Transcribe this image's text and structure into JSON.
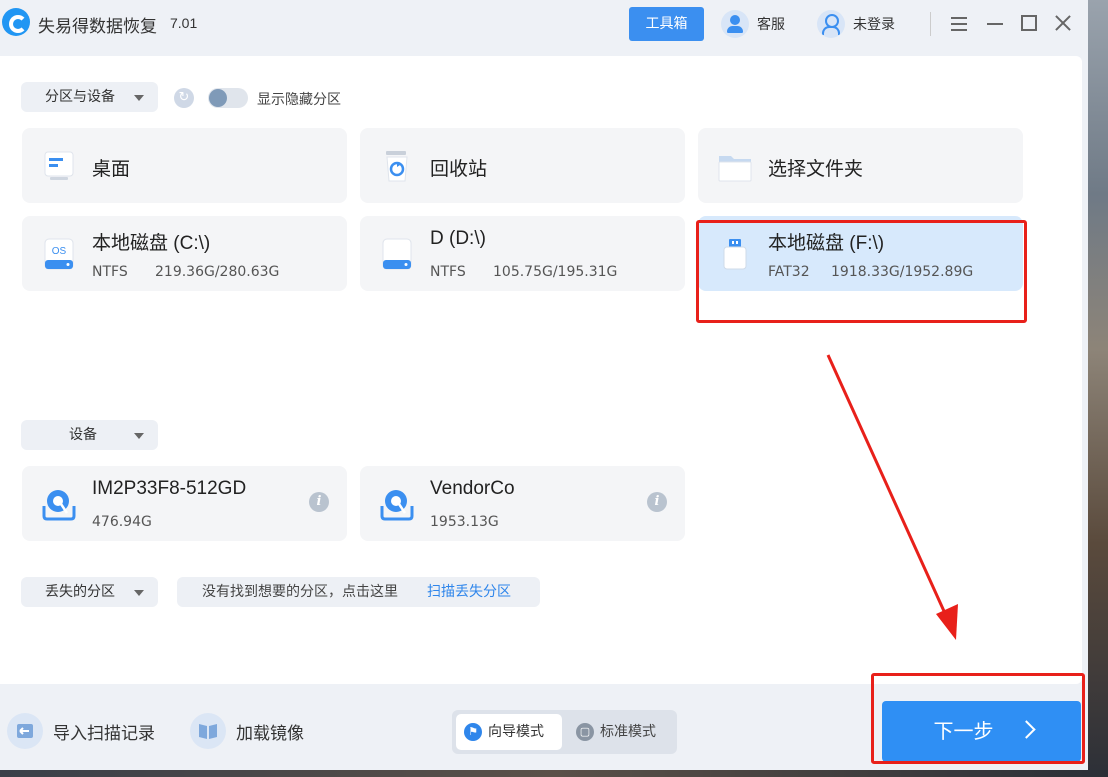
{
  "app": {
    "title": "失易得数据恢复",
    "version": "7.01"
  },
  "titlebar": {
    "toolbox": "工具箱",
    "service": "客服",
    "login": "未登录"
  },
  "partitions": {
    "dropdown_label": "分区与设备",
    "show_hidden_label": "显示隐藏分区",
    "quick_locations": [
      {
        "label": "桌面",
        "icon": "desktop-icon"
      },
      {
        "label": "回收站",
        "icon": "recycle-bin-icon"
      },
      {
        "label": "选择文件夹",
        "icon": "folder-icon"
      }
    ],
    "drives": [
      {
        "name": "本地磁盘 (C:\\)",
        "fs": "NTFS",
        "usage": "219.36G/280.63G",
        "icon": "os-disk-icon"
      },
      {
        "name": "D (D:\\)",
        "fs": "NTFS",
        "usage": "105.75G/195.31G",
        "icon": "disk-icon"
      },
      {
        "name": "本地磁盘 (F:\\)",
        "fs": "FAT32",
        "usage": "1918.33G/1952.89G",
        "icon": "usb-drive-icon",
        "selected": true
      }
    ]
  },
  "devices": {
    "dropdown_label": "设备",
    "items": [
      {
        "name": "IM2P33F8-512GD",
        "size": "476.94G",
        "icon": "hard-drive-icon"
      },
      {
        "name": "VendorCo",
        "size": "1953.13G",
        "icon": "hard-drive-icon"
      }
    ]
  },
  "lost": {
    "dropdown_label": "丢失的分区",
    "hint_text": "没有找到想要的分区，点击这里",
    "hint_link": "扫描丢失分区"
  },
  "bottom": {
    "import_label": "导入扫描记录",
    "mount_label": "加载镜像",
    "mode_wizard": "向导模式",
    "mode_standard": "标准模式",
    "next_label": "下一步"
  },
  "colors": {
    "accent": "#2f8ff4",
    "selected_card": "#d7e9fc",
    "annotation": "#e8201a"
  }
}
